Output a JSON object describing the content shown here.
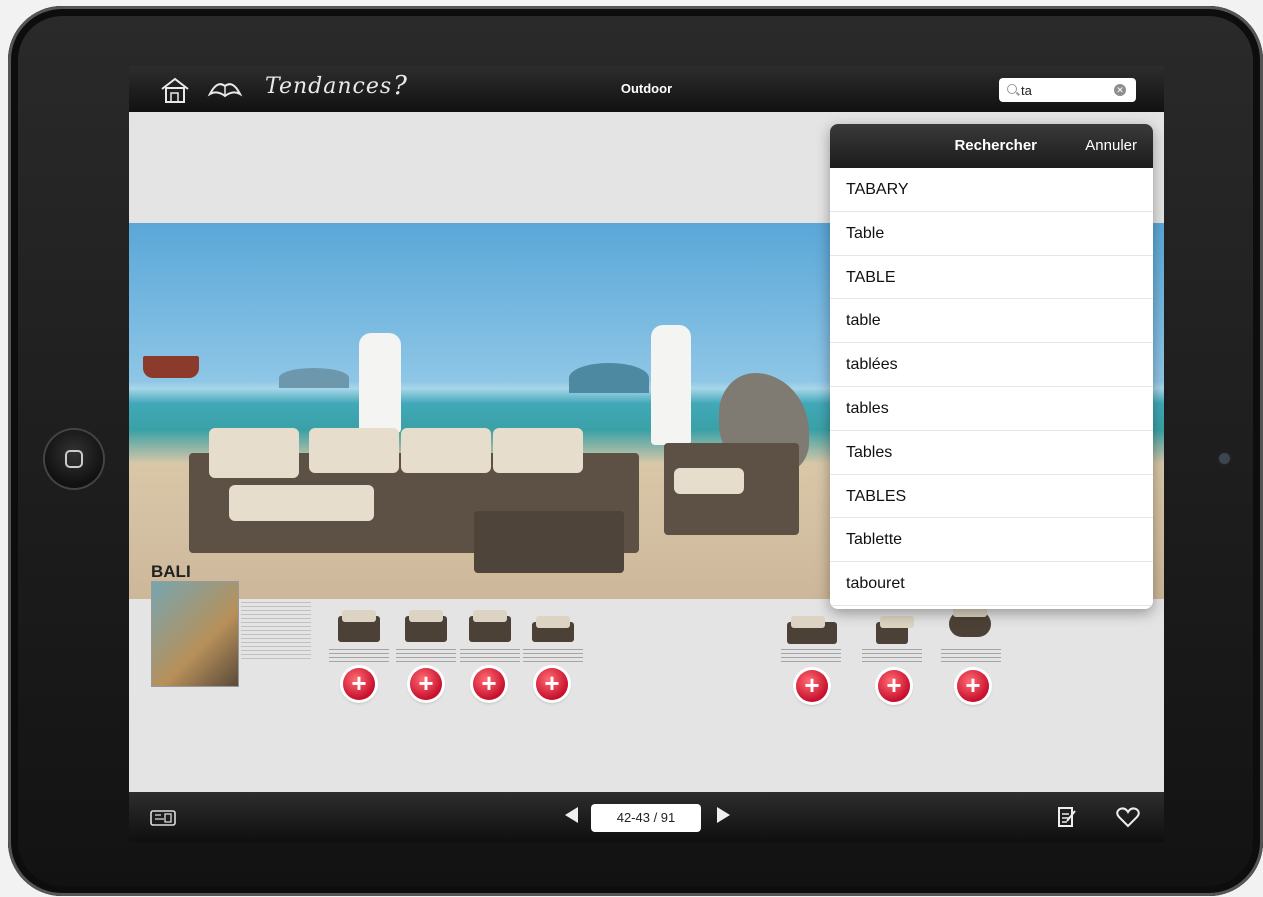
{
  "app": {
    "brand": "Tendances",
    "help": "?",
    "title": "Outdoor"
  },
  "search": {
    "value": "ta"
  },
  "dropdown": {
    "search_label": "Rechercher",
    "cancel_label": "Annuler",
    "suggestions": [
      "TABARY",
      "Table",
      "TABLE",
      "table",
      "tablées",
      "tables",
      "Tables",
      "TABLES",
      "Tablette",
      "tabouret"
    ]
  },
  "catalog": {
    "collection_label": "BALI"
  },
  "pager": {
    "pages": "42-43 / 91"
  },
  "colors": {
    "add_button": "#c8102e",
    "bar": "#1a1a1a"
  },
  "icons": [
    "home-icon",
    "book-icon",
    "search-icon",
    "clear-icon",
    "stamp-icon",
    "notes-icon",
    "heart-icon",
    "prev-icon",
    "next-icon",
    "plus-icon"
  ]
}
